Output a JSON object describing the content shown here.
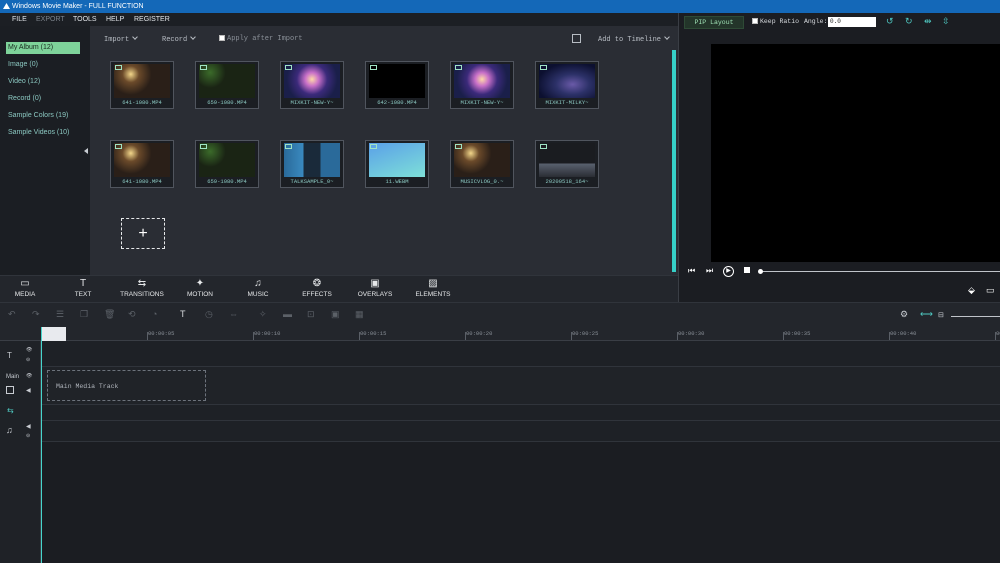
{
  "window": {
    "title": "Windows Movie Maker - FULL FUNCTION"
  },
  "menu": {
    "file": "FILE",
    "export": "EXPORT",
    "tools": "TOOLS",
    "help": "HELP",
    "register": "REGISTER"
  },
  "sidebar": {
    "items": [
      {
        "label": "My Album (12)"
      },
      {
        "label": "Image (0)"
      },
      {
        "label": "Video (12)"
      },
      {
        "label": "Record (0)"
      },
      {
        "label": "Sample Colors (19)"
      },
      {
        "label": "Sample Videos (10)"
      }
    ]
  },
  "library": {
    "import_label": "Import",
    "record_label": "Record",
    "apply_after_import": "Apply after Import",
    "add_to_timeline": "Add to Timeline",
    "media": [
      {
        "name": "641-1080.MP4",
        "thumb": "concert"
      },
      {
        "name": "659-1080.MP4",
        "thumb": "violin"
      },
      {
        "name": "MIXKIT-NEW-Y~",
        "thumb": "city"
      },
      {
        "name": "642-1080.MP4",
        "thumb": "black"
      },
      {
        "name": "MIXKIT-NEW-Y~",
        "thumb": "city"
      },
      {
        "name": "MIXKIT-MILKY~",
        "thumb": "galaxy"
      },
      {
        "name": "641-1080.MP4",
        "thumb": "concert"
      },
      {
        "name": "659-1080.MP4",
        "thumb": "violin"
      },
      {
        "name": "TALKSAMPLE_0~",
        "thumb": "person"
      },
      {
        "name": "11.WEBM",
        "thumb": "blue"
      },
      {
        "name": "MUSICVLOG_0.~",
        "thumb": "concert"
      },
      {
        "name": "20200518_164~",
        "thumb": "gray"
      }
    ],
    "add_symbol": "+"
  },
  "tabs": [
    {
      "label": "MEDIA",
      "icon": "folder-icon"
    },
    {
      "label": "TEXT",
      "icon": "text-icon"
    },
    {
      "label": "TRANSITIONS",
      "icon": "transitions-icon"
    },
    {
      "label": "MOTION",
      "icon": "motion-icon"
    },
    {
      "label": "MUSIC",
      "icon": "music-icon"
    },
    {
      "label": "EFFECTS",
      "icon": "effects-icon"
    },
    {
      "label": "OVERLAYS",
      "icon": "overlays-icon"
    },
    {
      "label": "ELEMENTS",
      "icon": "elements-icon"
    }
  ],
  "preview": {
    "pip_layout": "PIP Layout",
    "keep_ratio": "Keep Ratio",
    "angle_label": "Angle:",
    "angle_value": "0.0"
  },
  "timeline": {
    "ticks": [
      "00:00:05",
      "00:00:10",
      "00:00:15",
      "00:00:20",
      "00:00:25",
      "00:00:30",
      "00:00:35",
      "00:00:40",
      "00:00:4"
    ],
    "main_label": "Main",
    "main_track_text": "Main Media Track",
    "text_track_glyph": "T"
  },
  "colors": {
    "accent": "#36d0c8",
    "titlebar": "#1468b8",
    "active_item": "#7ed39a"
  }
}
